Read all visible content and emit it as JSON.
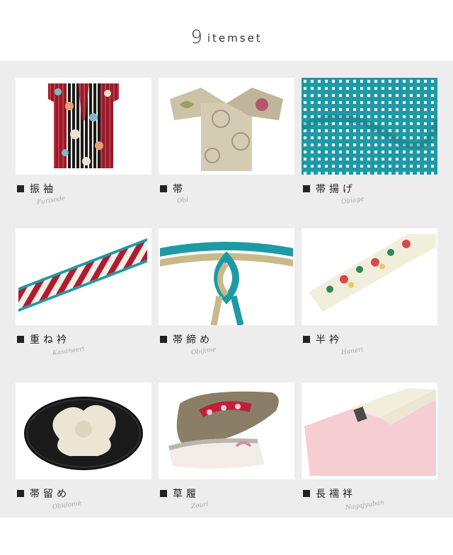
{
  "header": {
    "count": "9",
    "word": "itemset"
  },
  "items": [
    {
      "label": "振袖",
      "romaji": "Furisode"
    },
    {
      "label": "帯",
      "romaji": "Obi"
    },
    {
      "label": "帯揚げ",
      "romaji": "Obiage"
    },
    {
      "label": "重ね衿",
      "romaji": "Kasaneeri"
    },
    {
      "label": "帯締め",
      "romaji": "Obijime"
    },
    {
      "label": "半衿",
      "romaji": "Haneri"
    },
    {
      "label": "帯留め",
      "romaji": "Obidome"
    },
    {
      "label": "草履",
      "romaji": "Zouri"
    },
    {
      "label": "長襦袢",
      "romaji": "Nagajyuban"
    }
  ],
  "colors": {
    "panel": "#ededed",
    "teal": "#1e9aa6",
    "crimson": "#b01c2e",
    "cream": "#ece6d2",
    "pink": "#f6cdd3"
  }
}
